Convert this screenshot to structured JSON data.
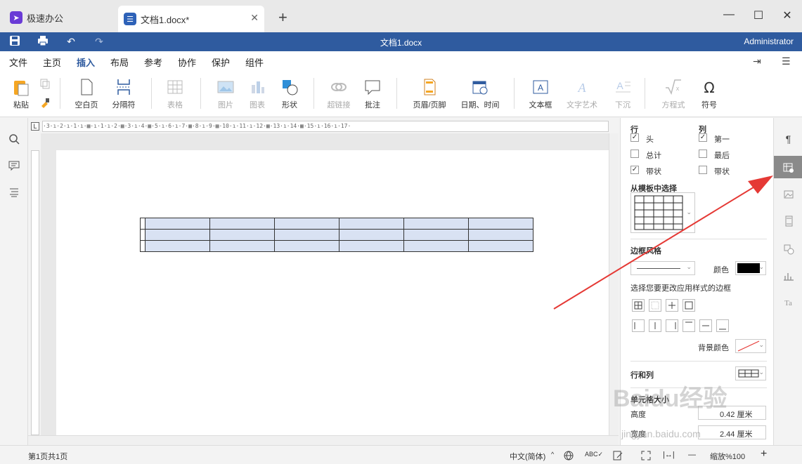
{
  "tabs": [
    {
      "label": "极速办公"
    },
    {
      "label": "文档1.docx*"
    }
  ],
  "titlebar": {
    "new_tab": "+",
    "minimize": "—",
    "maximize": "☐",
    "close": "✕"
  },
  "quickbar": {
    "title": "文档1.docx",
    "user": "Administrator"
  },
  "menu": [
    "文件",
    "主页",
    "插入",
    "布局",
    "参考",
    "协作",
    "保护",
    "组件"
  ],
  "active_menu": "插入",
  "ribbon": {
    "paste": "粘贴",
    "blank_page": "空白页",
    "page_break": "分隔符",
    "table": "表格",
    "picture": "图片",
    "chart": "图表",
    "shape": "形状",
    "hyperlink": "超链接",
    "comment": "批注",
    "header_footer": "页眉/页脚",
    "datetime": "日期、时间",
    "textbox": "文本框",
    "wordart": "文字艺术",
    "dropcap": "下沉",
    "equation": "方程式",
    "symbol": "符号"
  },
  "ruler": "·3·ı·2·ı·1·ı·▦·ı·1·ı·2·▦·3·ı·4·▦·5·ı·6·ı·7·▦·8·ı·9·▦·10·ı·11·ı·12·▦·13·ı·14·▦·15·ı·16·ı·17·",
  "panel": {
    "rows_title": "行",
    "cols_title": "列",
    "row_options": [
      {
        "label": "头",
        "checked": true
      },
      {
        "label": "总计",
        "checked": false
      },
      {
        "label": "带状",
        "checked": true
      }
    ],
    "col_options": [
      {
        "label": "第一",
        "checked": true
      },
      {
        "label": "最后",
        "checked": false
      },
      {
        "label": "带状",
        "checked": false
      }
    ],
    "template_label": "从模板中选择",
    "border_style": "边框风格",
    "color_label": "颜色",
    "border_hint": "选择您要更改应用样式的边框",
    "bg_color": "背景颜色",
    "rows_cols": "行和列",
    "cell_size": "单元格大小",
    "height_label": "高度",
    "height_value": "0.42 厘米",
    "width_label": "宽度",
    "width_value": "2.44 厘米"
  },
  "statusbar": {
    "page_info": "第1页共1页",
    "language": "中文(简体)",
    "zoom": "缩放%100"
  },
  "watermark": {
    "logo": "Baidu经验",
    "url": "jingyan.baidu.com"
  },
  "colors": {
    "accent": "#2f5b9f",
    "table_fill": "#d9e2f3",
    "arrow": "#e53935"
  }
}
